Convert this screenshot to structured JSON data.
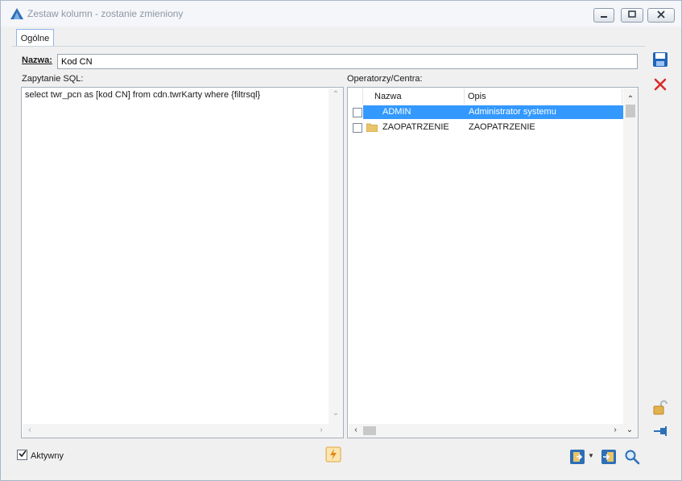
{
  "window": {
    "title": "Zestaw kolumn - zostanie zmieniony",
    "controls": {
      "minimize": "minimize-icon",
      "restore": "restore-icon",
      "close": "close-icon"
    }
  },
  "tabs": [
    {
      "label": "Ogólne",
      "active": true
    }
  ],
  "form": {
    "name_label": "Nazwa:",
    "name_value": "Kod CN",
    "sql_label": "Zapytanie SQL:",
    "sql_text": "select twr_pcn as [kod CN] from cdn.twrKarty where {filtrsql}",
    "operators_label": "Operatorzy/Centra:"
  },
  "operators_grid": {
    "columns": [
      "Nazwa",
      "Opis"
    ],
    "rows": [
      {
        "checked": false,
        "icon": "user-admin-icon",
        "name": "ADMIN",
        "description": "Administrator systemu",
        "selected": true
      },
      {
        "checked": false,
        "icon": "folder-icon",
        "name": "ZAOPATRZENIE",
        "description": "ZAOPATRZENIE",
        "selected": false
      }
    ]
  },
  "footer": {
    "active_label": "Aktywny",
    "active_checked": true
  },
  "colors": {
    "selection": "#3399ff",
    "accent": "#0b67c2",
    "delete": "#d92b2b",
    "folder": "#e9c46a"
  }
}
